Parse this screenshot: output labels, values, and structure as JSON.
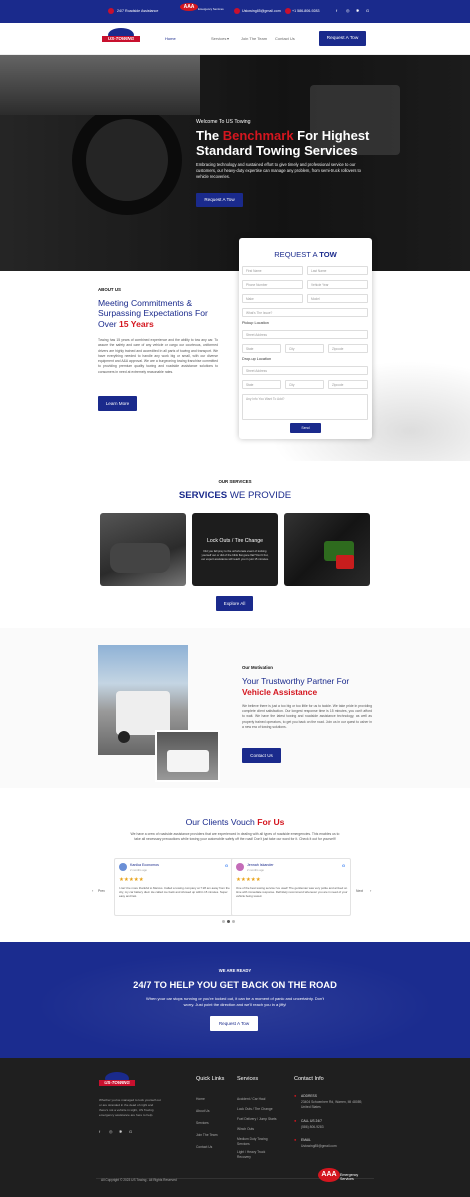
{
  "topbar": {
    "assist": "24/7 Roadside Assistance",
    "aaa_line1": "AAA",
    "aaa_line2": "Emergency Services",
    "email": "Ustowing85@gmail.com",
    "phone": "+1 586-806-9283"
  },
  "nav": {
    "logo": "US-TOWING",
    "items": [
      "Home",
      "Services",
      "Join The Team",
      "Contact Us"
    ],
    "cta": "Request A Tow"
  },
  "hero": {
    "welcome": "Welcome To US Towing",
    "line1_pre": "The ",
    "line1_red": "Benchmark",
    "line1_post": " For Highest",
    "line2": "Standard Towing Services",
    "desc": "Embracing technology and sustained effort to give timely and professional service to our customers, our heavy-duty expertise can manage any problem, from semi-truck rollovers to vehicle recoveries.",
    "button": "Request A Tow"
  },
  "form": {
    "title_pre": "REQUEST A ",
    "title_bold": "TOW",
    "first": "First Name",
    "last": "Last Name",
    "phone": "Phone Number",
    "vehicle_year": "Vehicle Year",
    "make": "Make",
    "model": "Model",
    "issue": "What's The Issue?",
    "pickup_label": "Pickup Location",
    "street1": "Street Address",
    "city1": "State",
    "city1b": "City",
    "zip1": "Zipcode",
    "dropoff_label": "Drop-up Location",
    "street2": "Street Address",
    "state2": "State",
    "city2": "City",
    "zip2": "Zipcode",
    "notes": "Any Info You Want To Add?",
    "send": "Send"
  },
  "about": {
    "label": "ABOUT US",
    "heading1": "Meeting Commitments &",
    "heading2": "Surpassing Expectations For",
    "heading3_pre": "Over ",
    "heading3_red": "15 Years",
    "body": "Towing has 15 years of combined experience and the ability to tow any car. To assure the safety and care of any vehicle or cargo our courteous, uniformed drivers are highly trained and accredited in all parts of towing and transport. We have everything needed to handle any work big or small, with our diverse equipment and A&A approval. We are a burgeoning towing franchise committed to providing premium quality towing and roadside assistance solutions to consumers in need at extremely reasonable rates.",
    "button": "Learn More"
  },
  "services": {
    "label": "OUR SERVICES",
    "heading_bold": "SERVICES",
    "heading_light": " WE PROVIDE",
    "card_title": "Lock Outs / Tire Change",
    "card_body": "Did you fall prey to the unfortunate event of locking yourself out or did of the blink flat gone flat? Don't fret, our expert assistance will reach you in just 15 minutes.",
    "button": "Explore All"
  },
  "motivation": {
    "label": "Our Motivation",
    "heading1": "Your Trustworthy Partner For",
    "heading2": "Vehicle Assistance",
    "body": "We believe there is just a too big or too little for us to tackle. We take pride in providing complete client satisfaction. Our longest response time is 15 minutes, you can't afford to wait. We have the latest towing and roadside assistance technology, as well as properly trained operators, to get you back on the road. Join us in our quest to usher in a new era of towing solutions.",
    "button": "Contact Us"
  },
  "testimonials": {
    "heading_pre": "Our Clients Vouch ",
    "heading_red": "For Us",
    "body": "We have a crew of roadside assistance providers that are experienced in dealing with all types of roadside emergencies. This enables us to take all necessary precautions while towing your automobile safely off the road! Don't just take our word for it. Check it out for yourself!",
    "prev": "Prev",
    "next": "Next",
    "reviews": [
      {
        "name": "Kanika Economos",
        "time": "2 months ago",
        "stars": "★★★★★",
        "text": "I can't be more thankful to Marcus. Called a towing company at 7:28 am away from the city, my car battery died. He called me back and showed up within 15 minutes. Super easy and fast."
      },
      {
        "name": "Jennah Iskander",
        "time": "2 months ago",
        "stars": "★★★★★",
        "text": "One of the best towing service I've used! The gentleman was very polite and arrived on time with immediate response. Definitely recommend whenever you are in need of your vehicle being towed."
      }
    ]
  },
  "cta": {
    "label": "WE ARE READY",
    "heading": "24/7 TO HELP YOU GET BACK ON THE ROAD",
    "body": "When your car stops running or you're locked out, it can be a moment of panic and uncertainty. Don't worry. Just point the direction and we'll reach you in a jiffy!",
    "button": "Request A Tow"
  },
  "footer": {
    "logo": "US-TOWING",
    "about": "Whether you've managed to lock yourself out or are stranded in the dead of night and there's not a vehicle in sight, US Towing emergency assistance are here to help.",
    "quick_title": "Quick Links",
    "quick": [
      "Home",
      "About Us",
      "Services",
      "Join The Team",
      "Contact Us"
    ],
    "services_title": "Services",
    "services": [
      "Accident / Car Haul",
      "Lock Outs / Tire Change",
      "Fuel Delivery / Jump Starts",
      "Winch Outs",
      "Medium Duty Towing Services",
      "Light / Heavy Truck Recovery"
    ],
    "contact_title": "Contact Info",
    "address_label": "ADDRESS",
    "address": "23404 Schoenherr Rd, Warren, MI 48089, United States",
    "call_label": "CALL US 24/7",
    "call": "(586) 806-9283",
    "email_label": "EMAIL",
    "email": "Ustowing85@gmail.com",
    "copyright": "All Copyright © 2023 US Towing . All Rights Reserved",
    "aaa_line1": "AAA",
    "aaa_line2": "Emergency Services"
  },
  "colors": {
    "brand_blue": "#1a2a8c",
    "accent_red": "#d4161f"
  }
}
